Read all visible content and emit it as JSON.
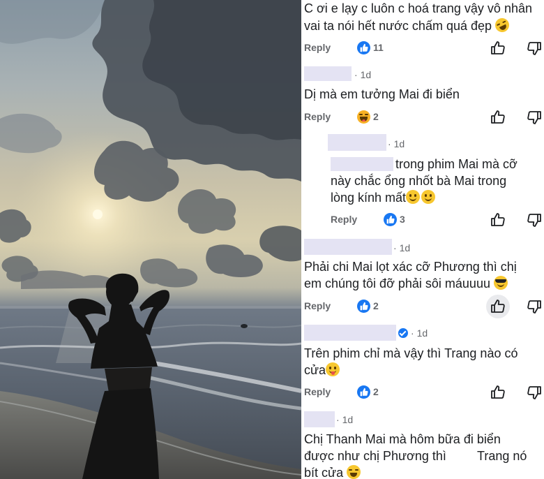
{
  "comments": [
    {
      "id": "c1",
      "author_hidden": true,
      "age": "",
      "text_lines": [
        "C ơi e lạy c luôn c hoá trang vậy vô nhân",
        "vai ta nói hết nước chấm quá đẹp"
      ],
      "emoji": "rolling-on-floor-laughing",
      "reply_label": "Reply",
      "reaction": {
        "type": "like",
        "count": "11"
      }
    },
    {
      "id": "c2",
      "author_hidden": true,
      "age": "1d",
      "text_lines": [
        "Dị mà em tưởng Mai đi biển"
      ],
      "reply_label": "Reply",
      "reaction": {
        "type": "haha",
        "count": "2"
      }
    },
    {
      "id": "c3",
      "is_reply": true,
      "author_hidden": true,
      "age": "1d",
      "text_lines": [
        "trong phim Mai mà cỡ",
        "này chắc ổng nhốt bà Mai trong",
        "lòng kính mất"
      ],
      "emoji": "grinning-x2",
      "reply_label": "Reply",
      "reaction": {
        "type": "like",
        "count": "3"
      }
    },
    {
      "id": "c4",
      "author_hidden": true,
      "age": "1d",
      "text_lines": [
        "Phải chi Mai lọt xác cỡ Phương thì chị",
        "em chúng tôi đỡ phải sôi máuuuu"
      ],
      "emoji": "sunglasses",
      "reply_label": "Reply",
      "reaction": {
        "type": "like",
        "count": "2"
      }
    },
    {
      "id": "c5",
      "author_hidden": true,
      "verified": true,
      "age": "1d",
      "text_lines": [
        "Trên phim chỉ mà vậy thì Trang nào có",
        "cửa"
      ],
      "emoji": "tongue",
      "reply_label": "Reply",
      "reaction": {
        "type": "like",
        "count": "2"
      }
    },
    {
      "id": "c6",
      "author_hidden": true,
      "age": "1d",
      "text_lines": [
        "Chị Thanh Mai mà hôm bữa đi biển",
        "được như chị Phương thì",
        "Trang nó",
        "bít cửa"
      ],
      "emoji": "laughing"
    }
  ],
  "icons": {
    "like_button": "thumbs-up-outline-icon",
    "dislike_button": "thumbs-down-outline-icon"
  },
  "colors": {
    "reaction_like": "#1877f2",
    "reaction_haha": "#f7b125",
    "meta_text": "#65676b",
    "redaction": "#e4e3f3"
  }
}
